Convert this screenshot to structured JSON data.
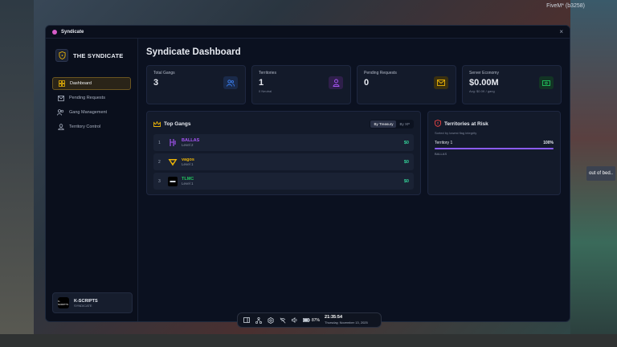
{
  "background": {
    "top_right_text": "FiveM* (b3258)",
    "bubble_text": "out of bed.."
  },
  "window": {
    "title": "Syndicate",
    "close_glyph": "×"
  },
  "sidebar": {
    "brand": "THE SYNDICATE",
    "items": [
      {
        "label": "Dashboard",
        "icon": "grid-icon",
        "active": true
      },
      {
        "label": "Pending Requests",
        "icon": "mail-icon",
        "active": false
      },
      {
        "label": "Gang Management",
        "icon": "users-icon",
        "active": false
      },
      {
        "label": "Territory Control",
        "icon": "map-person-icon",
        "active": false
      }
    ],
    "user": {
      "name": "K-SCRIPTS",
      "role": "SYNDICATE",
      "avatar_text": "K-SCRIPTS"
    }
  },
  "main": {
    "title": "Syndicate Dashboard",
    "stats": [
      {
        "label": "Total Gangs",
        "value": "3",
        "sub": "",
        "icon": "users-icon",
        "color": "#3b82f6"
      },
      {
        "label": "Territories",
        "value": "1",
        "sub": "0 Neutral",
        "icon": "pin-person-icon",
        "color": "#a855f7"
      },
      {
        "label": "Pending Requests",
        "value": "0",
        "sub": "",
        "icon": "envelope-icon",
        "color": "#eab308"
      },
      {
        "label": "Server Economy",
        "value": "$0.00M",
        "sub": "Avg: $0.0K / gang",
        "icon": "cash-icon",
        "color": "#22c55e"
      }
    ],
    "top_gangs": {
      "title": "Top Gangs",
      "toggle": [
        "By Treasury",
        "By XP"
      ],
      "rows": [
        {
          "rank": "1",
          "name": "BALLAS",
          "level": "Level 2",
          "money": "$0",
          "color": "#a855f7"
        },
        {
          "rank": "2",
          "name": "vagos",
          "level": "Level 1",
          "money": "$0",
          "color": "#eab308"
        },
        {
          "rank": "3",
          "name": "TLMC",
          "level": "Level 1",
          "money": "$0",
          "color": "#22c55e"
        }
      ]
    },
    "risk": {
      "title": "Territories at Risk",
      "subtitle": "Sorted by lowest flag integrity",
      "territory": "Territory 1",
      "percent": "100%",
      "percent_value": 100,
      "owner": "BALLAS"
    }
  },
  "taskbar": {
    "battery": "87%",
    "time": "21:35:54",
    "date": "Thursday, November 13, 2025"
  }
}
